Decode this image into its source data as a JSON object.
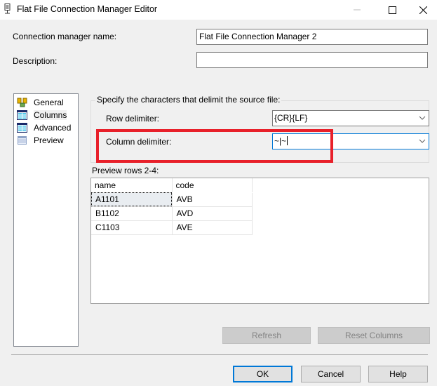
{
  "window": {
    "title": "Flat File Connection Manager Editor",
    "icon": "flat-file-connection-icon",
    "controls": [
      "minimize-icon",
      "maximize-icon",
      "close-icon"
    ]
  },
  "form": {
    "connection_name_label": "Connection manager name:",
    "connection_name_value": "Flat File Connection Manager 2",
    "description_label": "Description:",
    "description_value": ""
  },
  "sidebar": {
    "items": [
      {
        "label": "General",
        "icon": "general-icon",
        "selected": false
      },
      {
        "label": "Columns",
        "icon": "columns-icon",
        "selected": true
      },
      {
        "label": "Advanced",
        "icon": "advanced-icon",
        "selected": false
      },
      {
        "label": "Preview",
        "icon": "preview-icon",
        "selected": false
      }
    ]
  },
  "delimiters": {
    "group_title": "Specify the characters that delimit the source file:",
    "row_label": "Row delimiter:",
    "row_value": "{CR}{LF}",
    "column_label": "Column delimiter:",
    "column_value": "~|~"
  },
  "preview": {
    "label": "Preview rows 2-4:",
    "columns": [
      "name",
      "code"
    ],
    "rows": [
      [
        "A1101",
        "AVB"
      ],
      [
        "B1102",
        "AVD"
      ],
      [
        "C1103",
        "AVE"
      ]
    ]
  },
  "buttons": {
    "refresh": "Refresh",
    "reset_columns": "Reset Columns",
    "ok": "OK",
    "cancel": "Cancel",
    "help": "Help"
  },
  "colors": {
    "highlight_box": "#e8202a",
    "focus_border": "#0078d7"
  }
}
